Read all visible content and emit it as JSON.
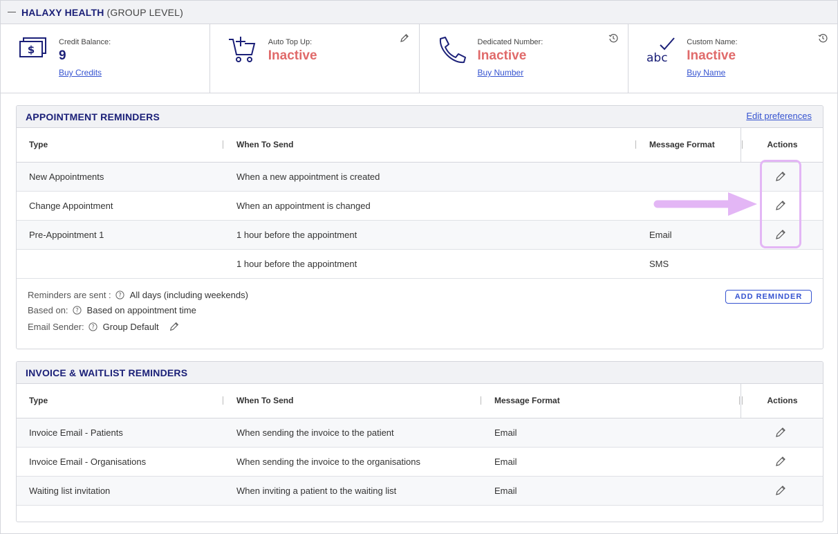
{
  "header": {
    "title": "HALAXY HEALTH",
    "subtitle": "(GROUP LEVEL)"
  },
  "cards": [
    {
      "label": "Credit Balance:",
      "value": "9",
      "link": "Buy Credits",
      "icon": "money-icon"
    },
    {
      "label": "Auto Top Up:",
      "value": "Inactive",
      "icon": "cart-plus-icon",
      "corner_icon": "pencil-icon"
    },
    {
      "label": "Dedicated Number:",
      "value": "Inactive",
      "link": "Buy Number",
      "icon": "phone-icon",
      "corner_icon": "history-icon"
    },
    {
      "label": "Custom Name:",
      "value": "Inactive",
      "link": "Buy Name",
      "icon": "abc-check-icon",
      "corner_icon": "history-icon"
    }
  ],
  "appointment": {
    "title": "APPOINTMENT REMINDERS",
    "edit_link": "Edit preferences",
    "columns": {
      "type": "Type",
      "when": "When To Send",
      "format": "Message Format",
      "actions": "Actions"
    },
    "rows": [
      {
        "type": "New Appointments",
        "when": "When a new appointment is created",
        "format": ""
      },
      {
        "type": "Change Appointment",
        "when": "When an appointment is changed",
        "format": ""
      },
      {
        "type": "Pre-Appointment 1",
        "when": "1 hour before the appointment",
        "format": "Email"
      },
      {
        "type": "",
        "when": "1 hour before the appointment",
        "format": "SMS"
      }
    ],
    "footer": {
      "sent_label": "Reminders are sent :",
      "sent_value": "All days (including weekends)",
      "based_label": "Based on:",
      "based_value": "Based on appointment time",
      "sender_label": "Email Sender:",
      "sender_value": "Group Default"
    },
    "add_button": "ADD REMINDER"
  },
  "invoice": {
    "title": "INVOICE & WAITLIST REMINDERS",
    "columns": {
      "type": "Type",
      "when": "When To Send",
      "format": "Message Format",
      "actions": "Actions"
    },
    "rows": [
      {
        "type": "Invoice Email - Patients",
        "when": "When sending the invoice to the patient",
        "format": "Email"
      },
      {
        "type": "Invoice Email - Organisations",
        "when": "When sending the invoice to the organisations",
        "format": "Email"
      },
      {
        "type": "Waiting list invitation",
        "when": "When inviting a patient to the waiting list",
        "format": "Email"
      }
    ]
  },
  "colors": {
    "brand": "#1b2078",
    "inactive": "#e06a6a",
    "link": "#3553d0",
    "highlight": "#e3b6f5"
  }
}
